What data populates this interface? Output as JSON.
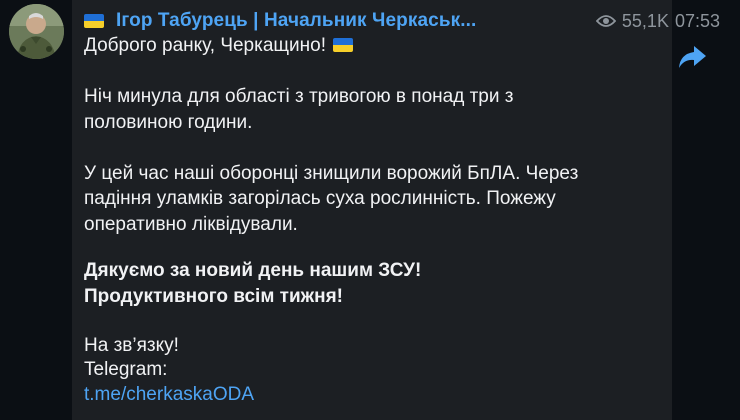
{
  "channel": {
    "name": "Ігор Табурець | Начальник Черкаськ...",
    "flag_icon": "ukraine-flag-icon",
    "avatar_icon": "profile-photo"
  },
  "meta": {
    "views": "55,1K",
    "time": "07:53",
    "views_icon": "eye-icon"
  },
  "actions": {
    "share_icon": "share-forward-icon"
  },
  "message": {
    "greeting": "Доброго ранку, Черкащино!",
    "para1_line1": "Ніч минула для області з тривогою в понад три з",
    "para1_line2": "половиною години.",
    "para2_line1": "У цей час наші оборонці знищили ворожий БпЛА. Через",
    "para2_line2": "падіння уламків загорілась суха рослинність. Пожежу",
    "para2_line3": "оперативно ліквідували.",
    "bold_line1": "Дякуємо за новий день нашим ЗСУ!",
    "bold_line2": "Продуктивного всім тижня!",
    "closing": "На зв’язку!",
    "telegram_label": "Telegram:",
    "link": "t.me/cherkaskaODA"
  },
  "colors": {
    "background": "#0b0f14",
    "bubble": "#1c1f23",
    "accent": "#4ea4f4",
    "text": "#f1f2f4",
    "muted": "#8e959c",
    "flag_blue": "#1f6fd6",
    "flag_yellow": "#f6cf2a"
  }
}
